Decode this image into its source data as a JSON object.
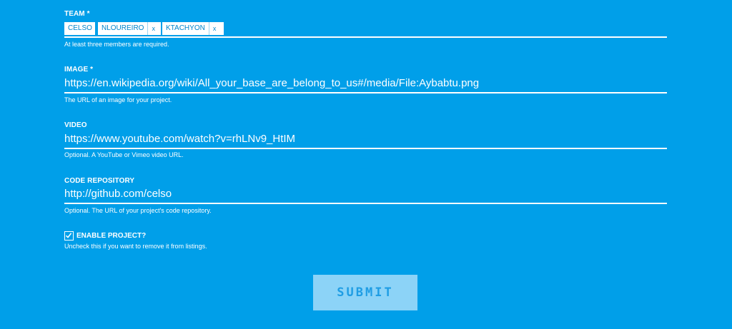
{
  "team": {
    "label": "TEAM *",
    "members": [
      {
        "name": "CELSO",
        "removable": false
      },
      {
        "name": "NLOUREIRO",
        "remove_label": "x"
      },
      {
        "name": "KTACHYON",
        "remove_label": "x"
      }
    ],
    "help": "At least three members are required."
  },
  "image": {
    "label": "IMAGE *",
    "value": "https://en.wikipedia.org/wiki/All_your_base_are_belong_to_us#/media/File:Aybabtu.png",
    "help": "The URL of an image for your project."
  },
  "video": {
    "label": "VIDEO",
    "value": "https://www.youtube.com/watch?v=rhLNv9_HtIM",
    "help": "Optional. A YouTube or Vimeo video URL."
  },
  "code_repository": {
    "label": "CODE REPOSITORY",
    "value": "http://github.com/celso",
    "help": "Optional. The URL of your project's code repository."
  },
  "enable_project": {
    "label": "ENABLE PROJECT?",
    "checked": true,
    "help": "Uncheck this if you want to remove it from listings."
  },
  "submit": {
    "label": "SUBMIT"
  },
  "colors": {
    "background": "#009fe9",
    "text": "#ffffff",
    "tag_text": "#0085cc",
    "submit_bg": "#8cd3f7",
    "submit_text": "#1e9de4"
  }
}
